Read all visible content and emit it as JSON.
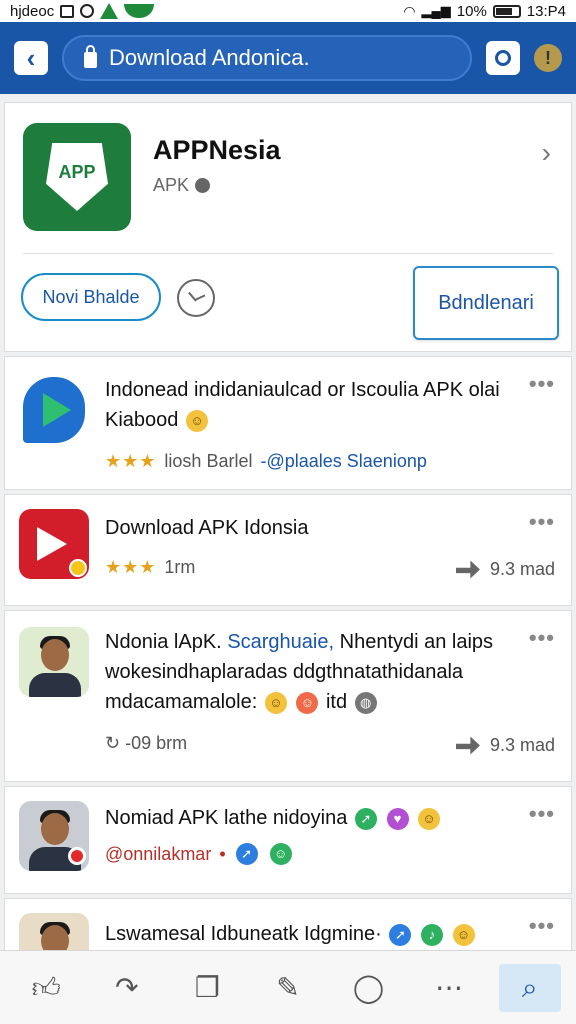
{
  "status_bar": {
    "left_text": "hjdeoc",
    "battery": "10%",
    "time": "13:P4"
  },
  "address_bar": {
    "url_text": "Download Andonica."
  },
  "app": {
    "name": "APPNesia",
    "subtitle": "APK",
    "icon_text": "APP",
    "primary_button": "Novi Bhalde",
    "download_button": "Bdndlenari"
  },
  "feed": [
    {
      "title": "Indonead indidaniaulcad or Iscoulia APK olai Kiabood",
      "meta_text": "liosh Barlel",
      "meta_link": "-@plaales Slaenionp"
    },
    {
      "title": "Download APK Idonsia",
      "meta_text": "1rm",
      "share_count": "9.3 mad"
    },
    {
      "title_lead": "Ndonia lApK.",
      "title_link": "Scarghuaie,",
      "title_rest": "Nhentydi an laips wokesindhaplaradas ddgthnatathidanala mdacamamalole:",
      "title_tail": "itd",
      "meta_text": "↻ -09 brm",
      "share_count": "9.3 mad"
    },
    {
      "title": "Nomiad APK lathe nidoyina",
      "handle": "@onnilakmar",
      "handle_sep": "•"
    },
    {
      "title": "Lswamesal Idbuneatk Idgmine·"
    }
  ],
  "bottom_nav": {
    "items": [
      "like-icon",
      "share-icon",
      "copy-icon",
      "edit-icon",
      "comment-icon",
      "more-icon",
      "search-icon"
    ],
    "active": "search-icon"
  },
  "colors": {
    "header_blue": "#1a56a8",
    "accent_green": "#1e7d3c",
    "star_gold": "#e6a21a"
  }
}
